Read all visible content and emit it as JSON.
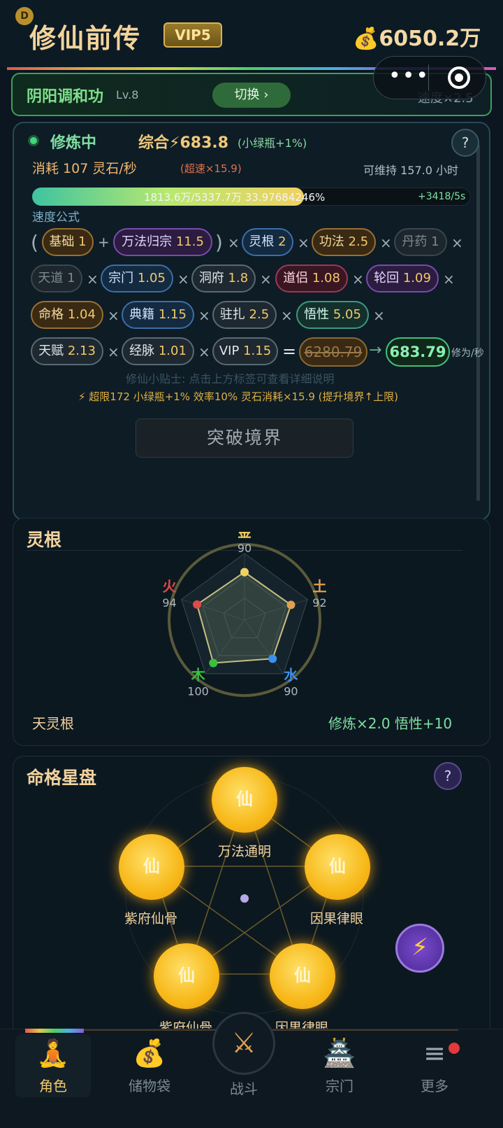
{
  "header": {
    "avatar_letter": "D",
    "title": "修仙前传",
    "vip": "VIP5",
    "money_icon": "💰",
    "money": "6050.2万"
  },
  "technique": {
    "name": "阴阳调和功",
    "level": "Lv.8",
    "switch_label": "切换 ›",
    "speed": "速度×2.5"
  },
  "cultivation": {
    "status": "修炼中",
    "total": "综合⚡683.8",
    "total_note": "(小绿瓶+1%)",
    "help": "?",
    "consume": "消耗 107 灵石/秒",
    "consume_boost": "(超速×15.9)",
    "maintain": "可维持 157.0 小时",
    "progress_fraction": 0.3398,
    "progress_text": "1813.6万/5337.7万  33.97684246%",
    "progress_rate": "+3418/5s",
    "formula_label": "速度公式",
    "factors": {
      "base": {
        "name": "基础",
        "value": "1"
      },
      "wanfa": {
        "name": "万法归宗",
        "value": "11.5"
      },
      "root": {
        "name": "灵根",
        "value": "2"
      },
      "gongfa": {
        "name": "功法",
        "value": "2.5"
      },
      "pill": {
        "name": "丹药",
        "value": "1"
      },
      "tiandao": {
        "name": "天道",
        "value": "1"
      },
      "sect": {
        "name": "宗门",
        "value": "1.05"
      },
      "cave": {
        "name": "洞府",
        "value": "1.8"
      },
      "partner": {
        "name": "道侣",
        "value": "1.08"
      },
      "reincarnation": {
        "name": "轮回",
        "value": "1.09"
      },
      "fate": {
        "name": "命格",
        "value": "1.04"
      },
      "books": {
        "name": "典籍",
        "value": "1.15"
      },
      "station": {
        "name": "驻扎",
        "value": "2.5"
      },
      "wisdom": {
        "name": "悟性",
        "value": "5.05"
      },
      "talent": {
        "name": "天赋",
        "value": "2.13"
      },
      "meridian": {
        "name": "经脉",
        "value": "1.01"
      },
      "vip": {
        "name": "VIP",
        "value": "1.15"
      }
    },
    "ops": {
      "open": "(",
      "close": ")",
      "plus": "+",
      "times": "×",
      "equals": "=",
      "arrow": "→"
    },
    "raw_result": "6280.79",
    "final_result": "683.79",
    "result_unit": "修为/秒",
    "tip": "修仙小贴士: 点击上方标签可查看详细说明",
    "limit_note": "⚡ 超限172 小绿瓶+1% 效率10% 灵石消耗×15.9 (提升境界↑上限)",
    "breakthrough_label": "突破境界"
  },
  "spirit_root": {
    "title": "灵根",
    "elements": [
      {
        "name": "金",
        "value": 90,
        "color": "#f0d060"
      },
      {
        "name": "土",
        "value": 92,
        "color": "#e0a050"
      },
      {
        "name": "水",
        "value": 90,
        "color": "#3a90f0"
      },
      {
        "name": "木",
        "value": 100,
        "color": "#3ac040"
      },
      {
        "name": "火",
        "value": 94,
        "color": "#e04a4a"
      }
    ],
    "type": "天灵根",
    "bonus": "修炼×2.0  悟性+10"
  },
  "fate_stars": {
    "title": "命格星盘",
    "help": "?",
    "stars": [
      {
        "glyph": "仙",
        "label": "万法通明"
      },
      {
        "glyph": "仙",
        "label": "紫府仙骨"
      },
      {
        "glyph": "仙",
        "label": "因果律眼"
      },
      {
        "glyph": "仙",
        "label": "紫府仙骨"
      },
      {
        "glyph": "仙",
        "label": "因果律眼"
      }
    ],
    "bolt": "⚡"
  },
  "nav": {
    "role": {
      "icon": "🧘",
      "label": "角色"
    },
    "bag": {
      "icon": "💰",
      "label": "储物袋"
    },
    "battle": {
      "icon": "⚔",
      "label": "战斗"
    },
    "sect": {
      "icon": "🏯",
      "label": "宗门"
    },
    "more": {
      "icon": "≡",
      "label": "更多"
    }
  }
}
